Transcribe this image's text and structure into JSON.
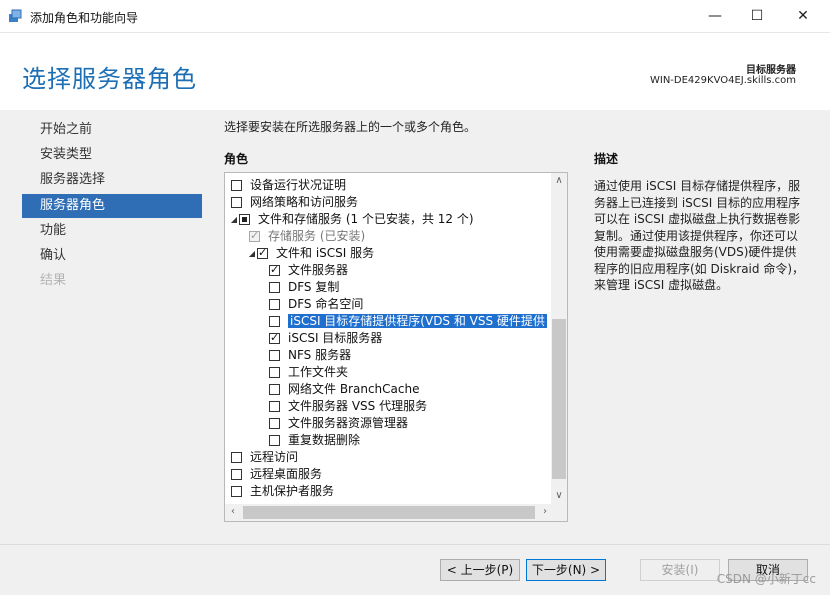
{
  "window": {
    "title": "添加角色和功能向导",
    "minimize": "—",
    "maximize": "☐",
    "close": "✕"
  },
  "header": {
    "page_title": "选择服务器角色",
    "target_label": "目标服务器",
    "target_value": "WIN-DE429KVO4EJ.skills.com"
  },
  "nav": {
    "items": [
      {
        "label": "开始之前",
        "state": "normal"
      },
      {
        "label": "安装类型",
        "state": "normal"
      },
      {
        "label": "服务器选择",
        "state": "normal"
      },
      {
        "label": "服务器角色",
        "state": "active"
      },
      {
        "label": "功能",
        "state": "normal"
      },
      {
        "label": "确认",
        "state": "normal"
      },
      {
        "label": "结果",
        "state": "disabled"
      }
    ]
  },
  "main": {
    "instruction": "选择要安装在所选服务器上的一个或多个角色。",
    "roles_header": "角色",
    "description_header": "描述",
    "description": "通过使用 iSCSI 目标存储提供程序，服务器上已连接到 iSCSI 目标的应用程序可以在 iSCSI 虚拟磁盘上执行数据卷影复制。通过使用该提供程序，你还可以使用需要虚拟磁盘服务(VDS)硬件提供程序的旧应用程序(如 Diskraid 命令)，来管理 iSCSI 虚拟磁盘。",
    "roles": [
      {
        "label": "设备运行状况证明",
        "level": 0,
        "state": "unchecked"
      },
      {
        "label": "网络策略和访问服务",
        "level": 0,
        "state": "unchecked"
      },
      {
        "label": "文件和存储服务 (1 个已安装，共 12 个)",
        "level": 0,
        "state": "partial",
        "expander": "◢"
      },
      {
        "label": "存储服务 (已安装)",
        "level": 1,
        "state": "disabled-checked"
      },
      {
        "label": "文件和 iSCSI 服务",
        "level": 1,
        "state": "checked",
        "expander": "◢"
      },
      {
        "label": "文件服务器",
        "level": 2,
        "state": "checked"
      },
      {
        "label": "DFS 复制",
        "level": 2,
        "state": "unchecked"
      },
      {
        "label": "DFS 命名空间",
        "level": 2,
        "state": "unchecked"
      },
      {
        "label": "iSCSI 目标存储提供程序(VDS 和 VSS 硬件提供",
        "level": 2,
        "state": "unchecked",
        "selected": true
      },
      {
        "label": "iSCSI 目标服务器",
        "level": 2,
        "state": "checked"
      },
      {
        "label": "NFS 服务器",
        "level": 2,
        "state": "unchecked"
      },
      {
        "label": "工作文件夹",
        "level": 2,
        "state": "unchecked"
      },
      {
        "label": "网络文件 BranchCache",
        "level": 2,
        "state": "unchecked"
      },
      {
        "label": "文件服务器 VSS 代理服务",
        "level": 2,
        "state": "unchecked"
      },
      {
        "label": "文件服务器资源管理器",
        "level": 2,
        "state": "unchecked"
      },
      {
        "label": "重复数据删除",
        "level": 2,
        "state": "unchecked"
      },
      {
        "label": "远程访问",
        "level": 0,
        "state": "unchecked"
      },
      {
        "label": "远程桌面服务",
        "level": 0,
        "state": "unchecked"
      },
      {
        "label": "主机保护者服务",
        "level": 0,
        "state": "unchecked"
      }
    ]
  },
  "footer": {
    "back": "< 上一步(P)",
    "next": "下一步(N) >",
    "install": "安装(I)",
    "cancel": "取消",
    "watermark": "CSDN @小新丁cc"
  },
  "colors": {
    "accent": "#1c6fb5",
    "nav_active": "#2f6db5",
    "selection": "#1e6fce"
  }
}
